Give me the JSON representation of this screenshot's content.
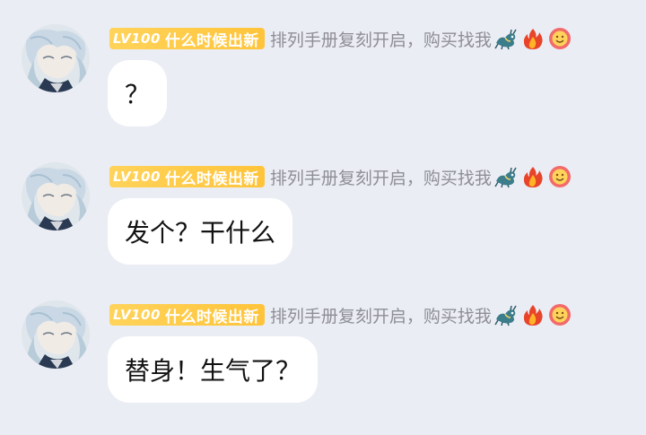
{
  "messages": [
    {
      "title": {
        "level": "LV100",
        "text": "什么时候出新"
      },
      "nickname": "排列手册复刻开启，购买找我",
      "badges": [
        "dragon-icon",
        "fire-icon",
        "smiley-flower-icon"
      ],
      "text": "？"
    },
    {
      "title": {
        "level": "LV100",
        "text": "什么时候出新"
      },
      "nickname": "排列手册复刻开启，购买找我",
      "badges": [
        "dragon-icon",
        "fire-icon",
        "smiley-flower-icon"
      ],
      "text": "发个？干什么"
    },
    {
      "title": {
        "level": "LV100",
        "text": "什么时候出新"
      },
      "nickname": "排列手册复刻开启，购买找我",
      "badges": [
        "dragon-icon",
        "fire-icon",
        "smiley-flower-icon"
      ],
      "text": "替身！生气了？"
    }
  ],
  "colors": {
    "background": "#ebedf5",
    "title_badge": "#ffc43a",
    "nickname": "#8e8f94",
    "bubble": "#ffffff"
  }
}
